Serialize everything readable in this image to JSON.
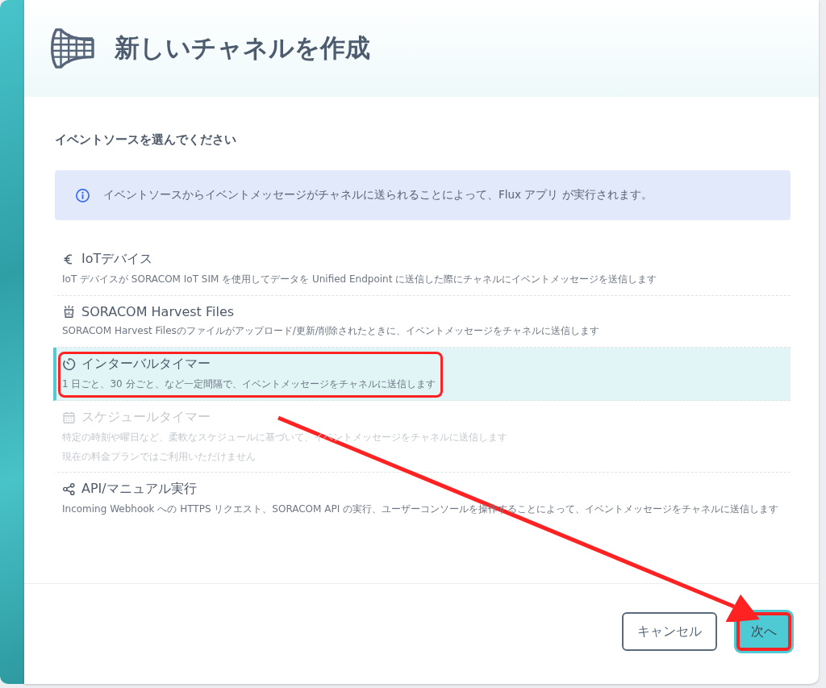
{
  "dialog": {
    "title": "新しいチャネルを作成",
    "subtitle": "イベントソースを選んでください",
    "info": "イベントソースからイベントメッセージがチャネルに送られることによって、Flux アプリ が実行されます。",
    "options": [
      {
        "kind": "device",
        "title": "IoTデバイス",
        "description": "IoT デバイスが SORACOM IoT SIM を使用してデータを Unified Endpoint に送信した際にチャネルにイベントメッセージを送信します",
        "selected": false,
        "disabled": false,
        "highlighted": false
      },
      {
        "kind": "harvest",
        "title": "SORACOM Harvest Files",
        "description": "SORACOM Harvest Filesのファイルがアップロード/更新/削除されたときに、イベントメッセージをチャネルに送信します",
        "selected": false,
        "disabled": false,
        "highlighted": false
      },
      {
        "kind": "timer",
        "title": "インターバルタイマー",
        "description": "1 日ごと、30 分ごと、など一定間隔で、イベントメッセージをチャネルに送信します",
        "selected": true,
        "disabled": false,
        "highlighted": true
      },
      {
        "kind": "calendar",
        "title": "スケジュールタイマー",
        "description": "特定の時刻や曜日など、柔軟なスケジュールに基づいて、イベントメッセージをチャネルに送信します",
        "note": "現在の料金プランではご利用いただけません",
        "selected": false,
        "disabled": true,
        "highlighted": false
      },
      {
        "kind": "share",
        "title": "API/マニュアル実行",
        "description": "Incoming Webhook への HTTPS リクエスト、SORACOM API の実行、ユーザーコンソールを操作することによって、イベントメッセージをチャネルに送信します",
        "selected": false,
        "disabled": false,
        "highlighted": false
      }
    ],
    "buttons": [
      {
        "kind": "secondary",
        "label": "キャンセル",
        "highlighted": false
      },
      {
        "kind": "primary",
        "label": "次へ",
        "highlighted": true
      }
    ]
  }
}
